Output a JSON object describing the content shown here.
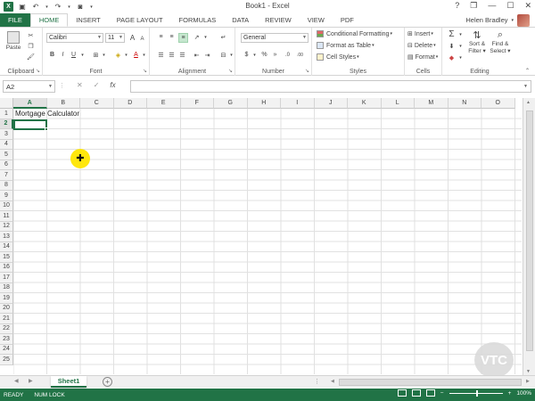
{
  "window": {
    "title": "Book1 - Excel",
    "help": "?",
    "restore": "❐",
    "minimize": "—",
    "maximize": "☐",
    "close": "✕"
  },
  "qat": {
    "logo": "X",
    "save_icon": "💾",
    "undo_icon": "↶",
    "redo_icon": "↷",
    "camera_icon": "📷",
    "more_icon": "▾"
  },
  "tabs": [
    {
      "label": "FILE"
    },
    {
      "label": "HOME"
    },
    {
      "label": "INSERT"
    },
    {
      "label": "PAGE LAYOUT"
    },
    {
      "label": "FORMULAS"
    },
    {
      "label": "DATA"
    },
    {
      "label": "REVIEW"
    },
    {
      "label": "VIEW"
    },
    {
      "label": "PDF"
    }
  ],
  "user": {
    "name": "Helen Bradley"
  },
  "ribbon": {
    "clipboard": {
      "label": "Clipboard",
      "paste": "Paste"
    },
    "font": {
      "label": "Font",
      "font_name": "Calibri",
      "font_size": "11",
      "bold": "B",
      "italic": "I",
      "underline": "U",
      "grow": "A",
      "shrink": "A",
      "font_color": "A"
    },
    "alignment": {
      "label": "Alignment"
    },
    "number": {
      "label": "Number",
      "format": "General",
      "currency": "$",
      "percent": "%",
      "comma": "»",
      "inc_dec": ".0",
      "dec_dec": ".00"
    },
    "styles": {
      "label": "Styles",
      "conditional": "Conditional Formatting",
      "format_table": "Format as Table",
      "cell_styles": "Cell Styles"
    },
    "cells": {
      "label": "Cells",
      "insert": "Insert",
      "delete": "Delete",
      "format": "Format"
    },
    "editing": {
      "label": "Editing",
      "sum": "Σ",
      "sort": "Sort &",
      "filter": "Filter",
      "find": "Find &",
      "select": "Select"
    }
  },
  "formula_bar": {
    "name_box": "A2",
    "cancel": "✕",
    "enter": "✓",
    "fx": "fx",
    "value": ""
  },
  "grid": {
    "columns": [
      "A",
      "B",
      "C",
      "D",
      "E",
      "F",
      "G",
      "H",
      "I",
      "J",
      "K",
      "L",
      "M",
      "N",
      "O"
    ],
    "rows": [
      "1",
      "2",
      "3",
      "4",
      "5",
      "6",
      "7",
      "8",
      "9",
      "10",
      "11",
      "12",
      "13",
      "14",
      "15",
      "16",
      "17",
      "18",
      "19",
      "20",
      "21",
      "22",
      "23",
      "24",
      "25"
    ],
    "active_cell": "A2",
    "cells": {
      "A1": "Mortgage Calculator"
    }
  },
  "sheets": {
    "active": "Sheet1",
    "add": "+"
  },
  "status": {
    "ready": "READY",
    "num_lock": "NUM LOCK",
    "zoom": "100%",
    "zoom_out": "−",
    "zoom_in": "+"
  },
  "watermark": "VTC",
  "colors": {
    "accent": "#217346",
    "cursor_highlight": "#ffe600"
  }
}
